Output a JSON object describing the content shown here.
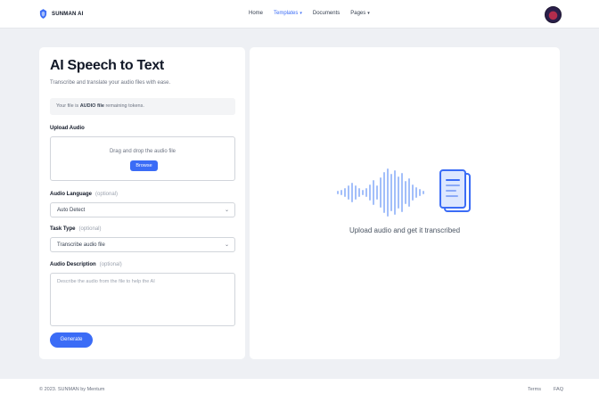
{
  "header": {
    "logo_text": "SUNMAN AI",
    "nav": [
      {
        "label": "Home",
        "active": false
      },
      {
        "label": "Templates",
        "active": true,
        "dropdown": true
      },
      {
        "label": "Documents",
        "active": false
      },
      {
        "label": "Pages",
        "active": false,
        "dropdown": true
      }
    ]
  },
  "left": {
    "title": "AI Speech to Text",
    "subtitle": "Transcribe and translate your audio files with ease.",
    "info_prefix": "Your file is",
    "info_strong": "AUDIO file",
    "info_suffix": "remaining tokens.",
    "upload_label": "Upload Audio",
    "upload_text": "Drag and drop the audio file",
    "browse_label": "Browse",
    "language_label": "Audio Language",
    "language_optional": "(optional)",
    "language_value": "Auto Detect",
    "task_label": "Task Type",
    "task_optional": "(optional)",
    "task_value": "Transcribe audio file",
    "description_label": "Audio Description",
    "description_optional": "(optional)",
    "description_placeholder": "Describe the audio from the file to help the AI",
    "submit_label": "Generate"
  },
  "right": {
    "empty_text": "Upload audio and get it transcribed"
  },
  "footer": {
    "copyright": "© 2023. SUNMAN by Mentum",
    "links": [
      "Terms",
      "FAQ"
    ]
  },
  "colors": {
    "accent": "#3b6cf6",
    "background": "#eef0f4",
    "panel": "#ffffff"
  }
}
